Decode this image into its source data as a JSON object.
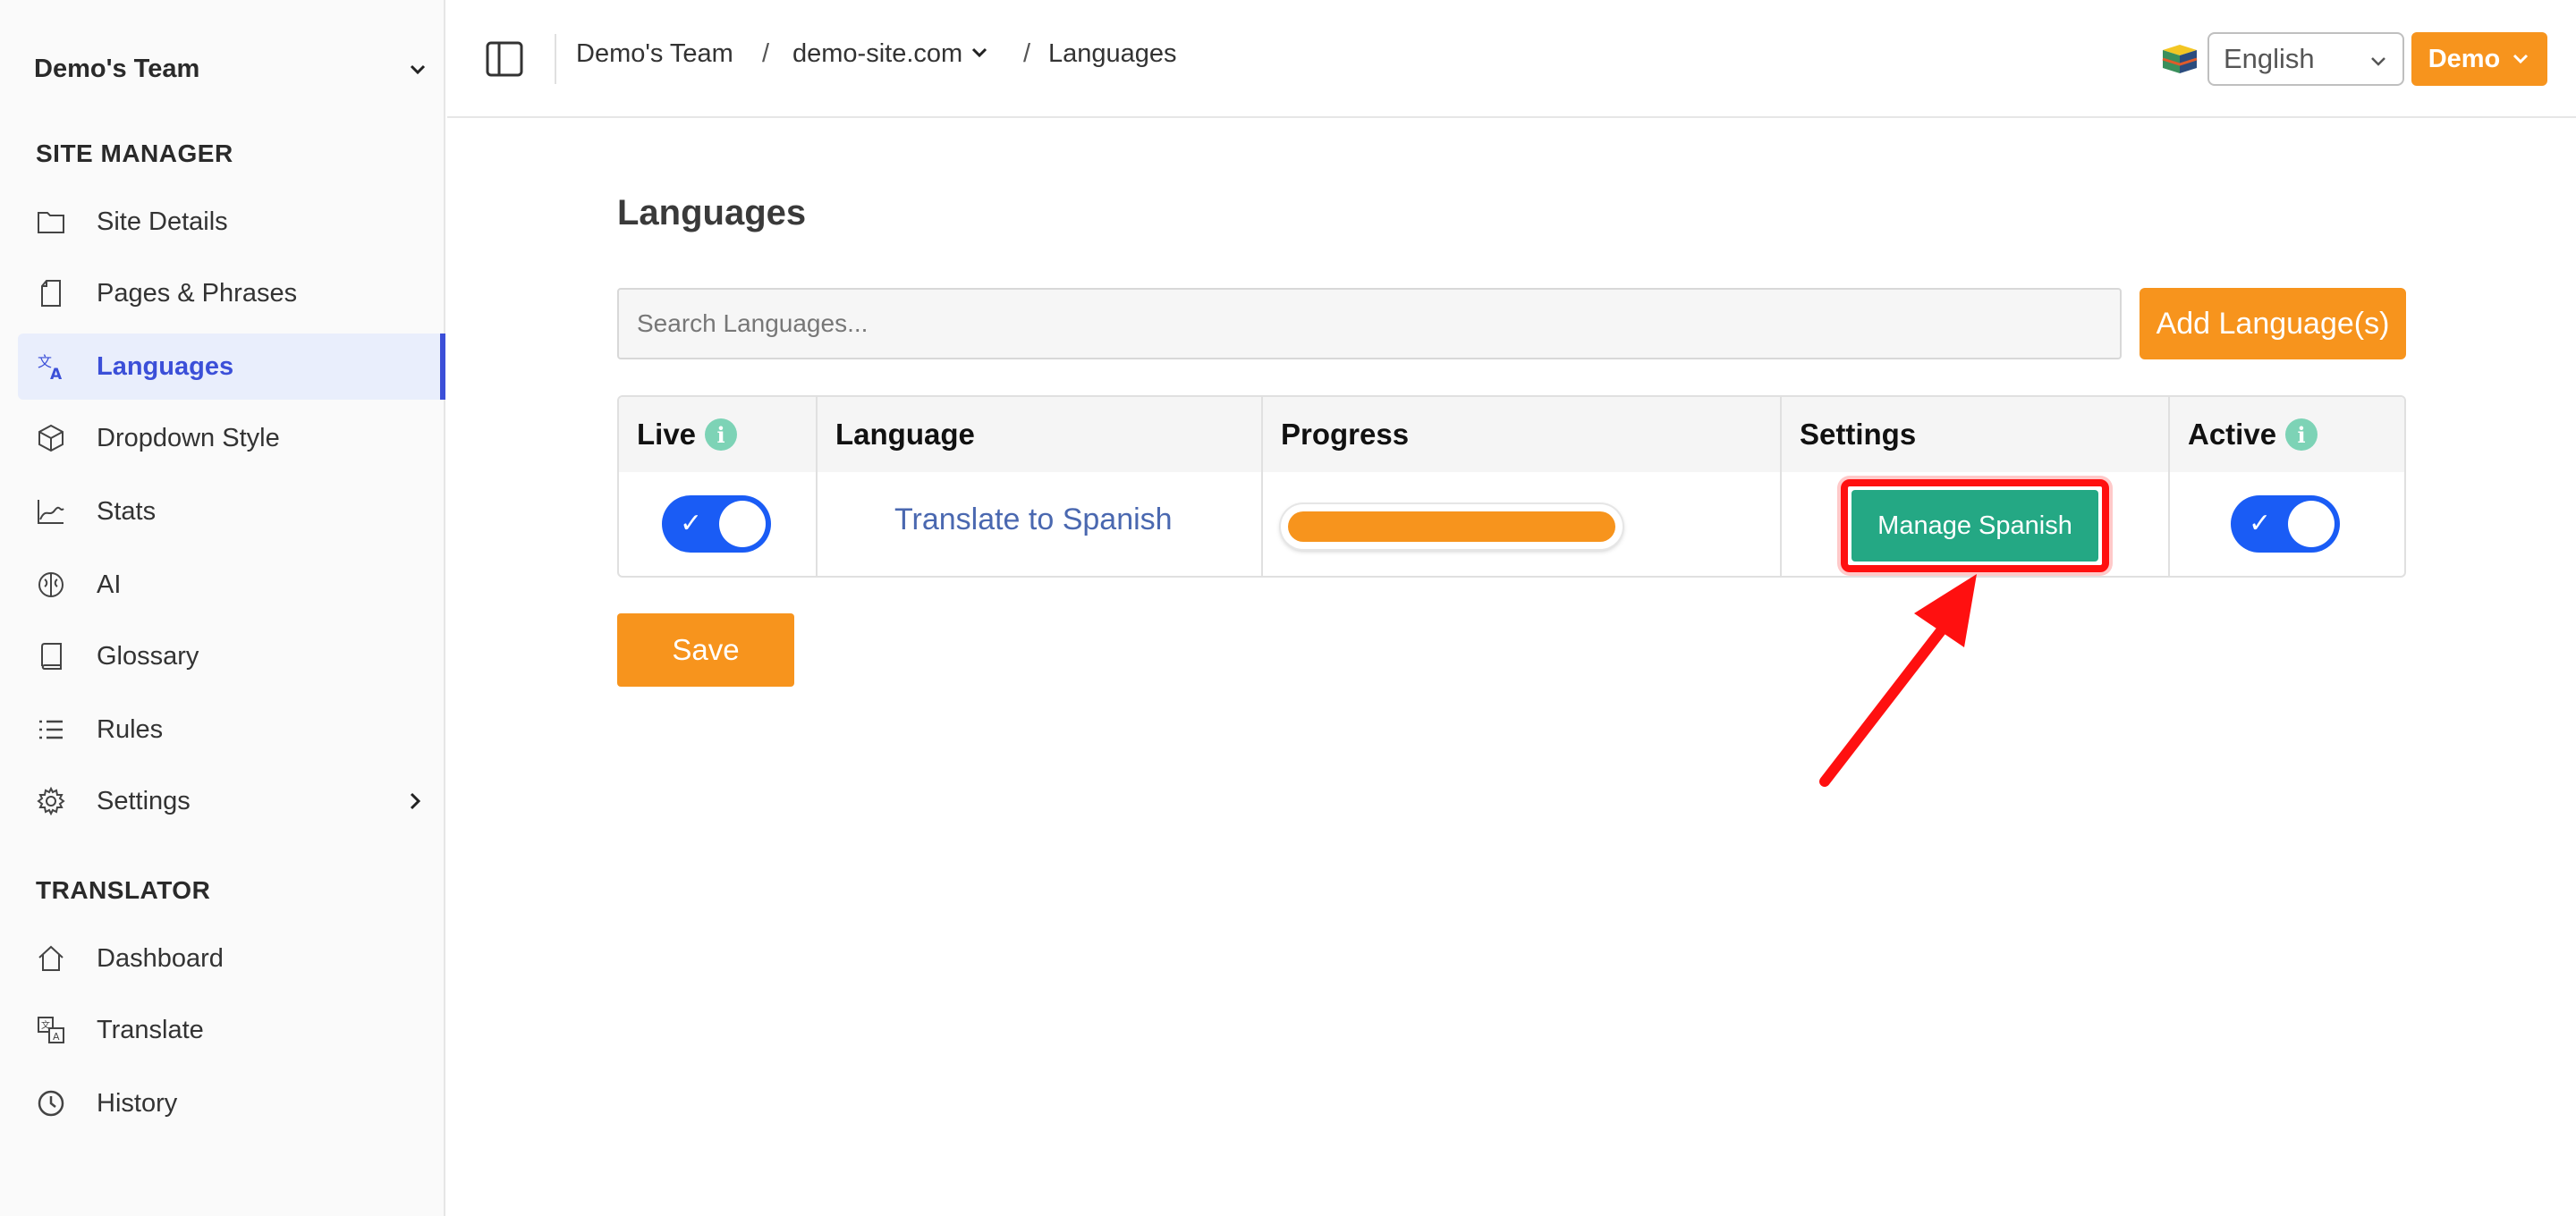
{
  "sidebar": {
    "team_name": "Demo's Team",
    "site_manager_title": "SITE MANAGER",
    "site_items": [
      {
        "label": "Site Details",
        "icon": "folder-icon"
      },
      {
        "label": "Pages & Phrases",
        "icon": "page-icon"
      },
      {
        "label": "Languages",
        "icon": "translate-icon",
        "active": true
      },
      {
        "label": "Dropdown Style",
        "icon": "cube-icon"
      },
      {
        "label": "Stats",
        "icon": "chart-line-icon"
      },
      {
        "label": "AI",
        "icon": "brain-icon"
      },
      {
        "label": "Glossary",
        "icon": "book-icon"
      },
      {
        "label": "Rules",
        "icon": "list-icon"
      },
      {
        "label": "Settings",
        "icon": "gear-icon"
      }
    ],
    "translator_title": "TRANSLATOR",
    "translator_items": [
      {
        "label": "Dashboard",
        "icon": "home-icon"
      },
      {
        "label": "Translate",
        "icon": "translate-box-icon"
      },
      {
        "label": "History",
        "icon": "clock-icon"
      }
    ]
  },
  "topbar": {
    "breadcrumb": {
      "team": "Demo's Team",
      "site": "demo-site.com",
      "page": "Languages",
      "separator": "/"
    },
    "language_select": "English",
    "user_button": "Demo"
  },
  "main": {
    "title": "Languages",
    "search_placeholder": "Search Languages...",
    "add_button": "Add Language(s)",
    "table": {
      "headers": {
        "live": "Live",
        "language": "Language",
        "progress": "Progress",
        "settings": "Settings",
        "active": "Active"
      },
      "rows": [
        {
          "live": true,
          "language_link": "Translate to Spanish",
          "progress_percent": 100,
          "settings_button": "Manage Spanish",
          "active": true
        }
      ]
    },
    "save_button": "Save"
  },
  "colors": {
    "accent_orange": "#f7941d",
    "toggle_blue": "#1a5cf5",
    "manage_green": "#24a884",
    "active_nav": "#3b4fd8",
    "annotation_red": "#ff1010"
  }
}
